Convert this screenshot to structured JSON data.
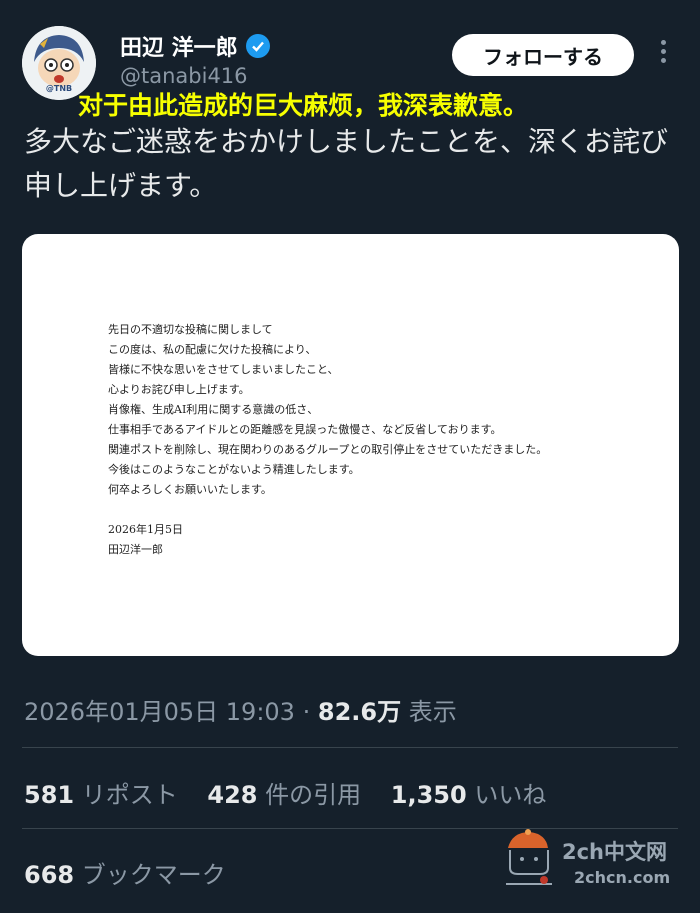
{
  "user": {
    "name": "田辺 洋一郎",
    "handle": "@tanabi416",
    "avatar_label": "@TNB"
  },
  "follow_label": "フォローする",
  "overlay_subtitle": "对于由此造成的巨大麻烦，我深表歉意。",
  "tweet_text": "多大なご迷惑をおかけしましたことを、深くお詫び申し上げます。",
  "letter": {
    "lines": [
      "先日の不適切な投稿に関しまして",
      "この度は、私の配慮に欠けた投稿により、",
      "皆様に不快な思いをさせてしまいましたこと、",
      "心よりお詫び申し上げます。",
      "肖像権、生成AI利用に関する意識の低さ、",
      "仕事相手であるアイドルとの距離感を見誤った傲慢さ、など反省しております。",
      "関連ポストを削除し、現在関わりのあるグループとの取引停止をさせていただきました。",
      "今後はこのようなことがないよう精進したします。",
      "何卒よろしくお願いいたします。"
    ],
    "date": "2026年1月5日",
    "signature": "田辺洋一郎"
  },
  "meta": {
    "timestamp": "2026年01月05日 19:03",
    "separator": "·",
    "views": "82.6万",
    "views_label": "表示"
  },
  "stats": {
    "reposts": "581",
    "reposts_label": "リポスト",
    "quotes": "428",
    "quotes_label": "件の引用",
    "likes": "1,350",
    "likes_label": "いいね",
    "bookmarks": "668",
    "bookmarks_label": "ブックマーク"
  },
  "watermark": {
    "line1": "2ch中文网",
    "line2": "2chcn.com"
  },
  "colors": {
    "background": "#15202b",
    "verified": "#1d9bf0",
    "subtitle": "#f7ff00",
    "secondary_text": "#8b98a5"
  }
}
